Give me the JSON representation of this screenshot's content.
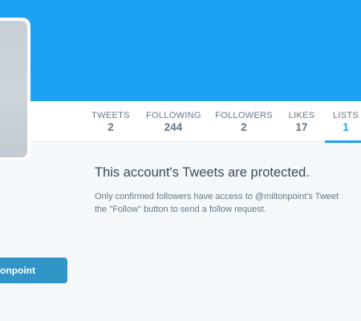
{
  "colors": {
    "accent": "#1da1f2",
    "button": "#3194c6",
    "background": "#f5f8fa"
  },
  "nav": {
    "items": [
      {
        "label": "TWEETS",
        "value": "2"
      },
      {
        "label": "FOLLOWING",
        "value": "244"
      },
      {
        "label": "FOLLOWERS",
        "value": "2"
      },
      {
        "label": "LIKES",
        "value": "17"
      },
      {
        "label": "LISTS",
        "value": "1"
      }
    ],
    "active": "LISTS"
  },
  "protected": {
    "title": "This account's Tweets are protected.",
    "line1": "Only confirmed followers have access to @miltonpoint's Tweet",
    "line2": "the \"Follow\" button to send a follow request."
  },
  "follow_button": {
    "label": "onpoint"
  }
}
